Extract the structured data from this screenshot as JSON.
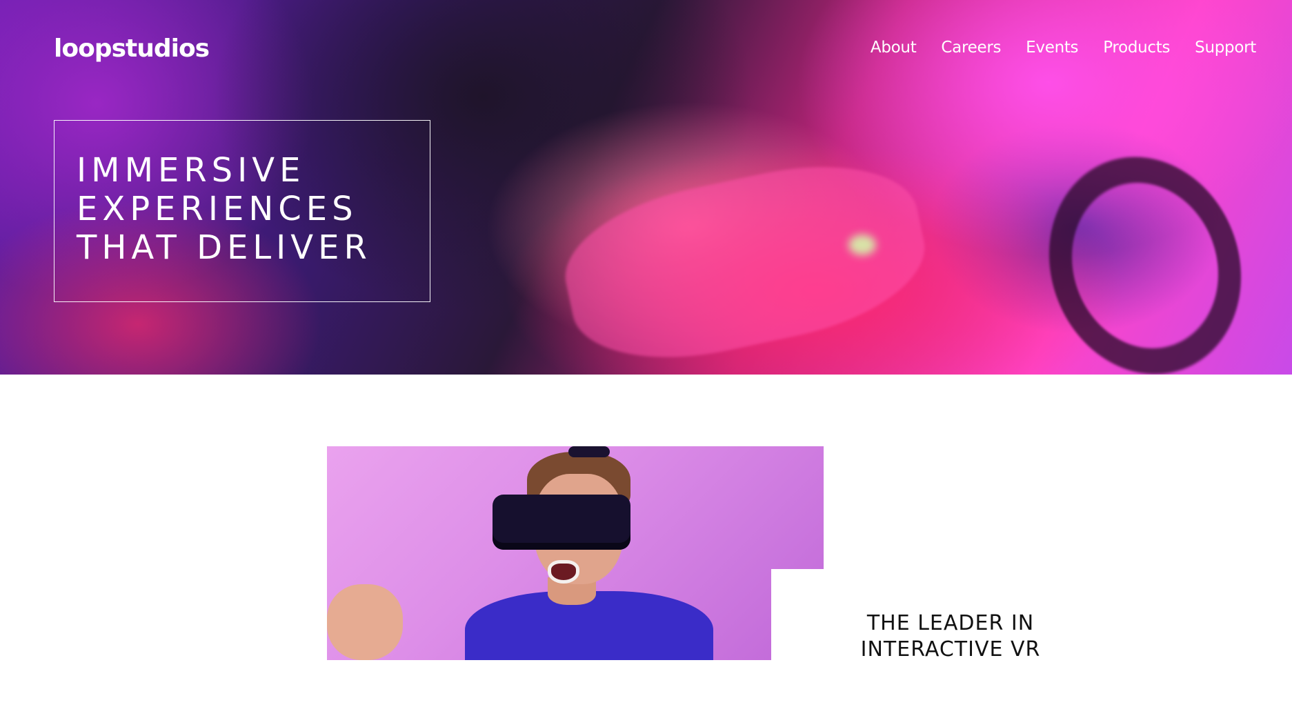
{
  "header": {
    "logo": "loopstudios",
    "nav": [
      "About",
      "Careers",
      "Events",
      "Products",
      "Support"
    ]
  },
  "hero": {
    "headline_lines": [
      "IMMERSIVE",
      "EXPERIENCES",
      "THAT DELIVER"
    ]
  },
  "interactive": {
    "title": "THE LEADER IN INTERACTIVE VR"
  },
  "colors": {
    "hero_tint": "#ff44c8",
    "text_light": "#ffffff",
    "text_dark": "#111111",
    "background": "#ffffff"
  }
}
